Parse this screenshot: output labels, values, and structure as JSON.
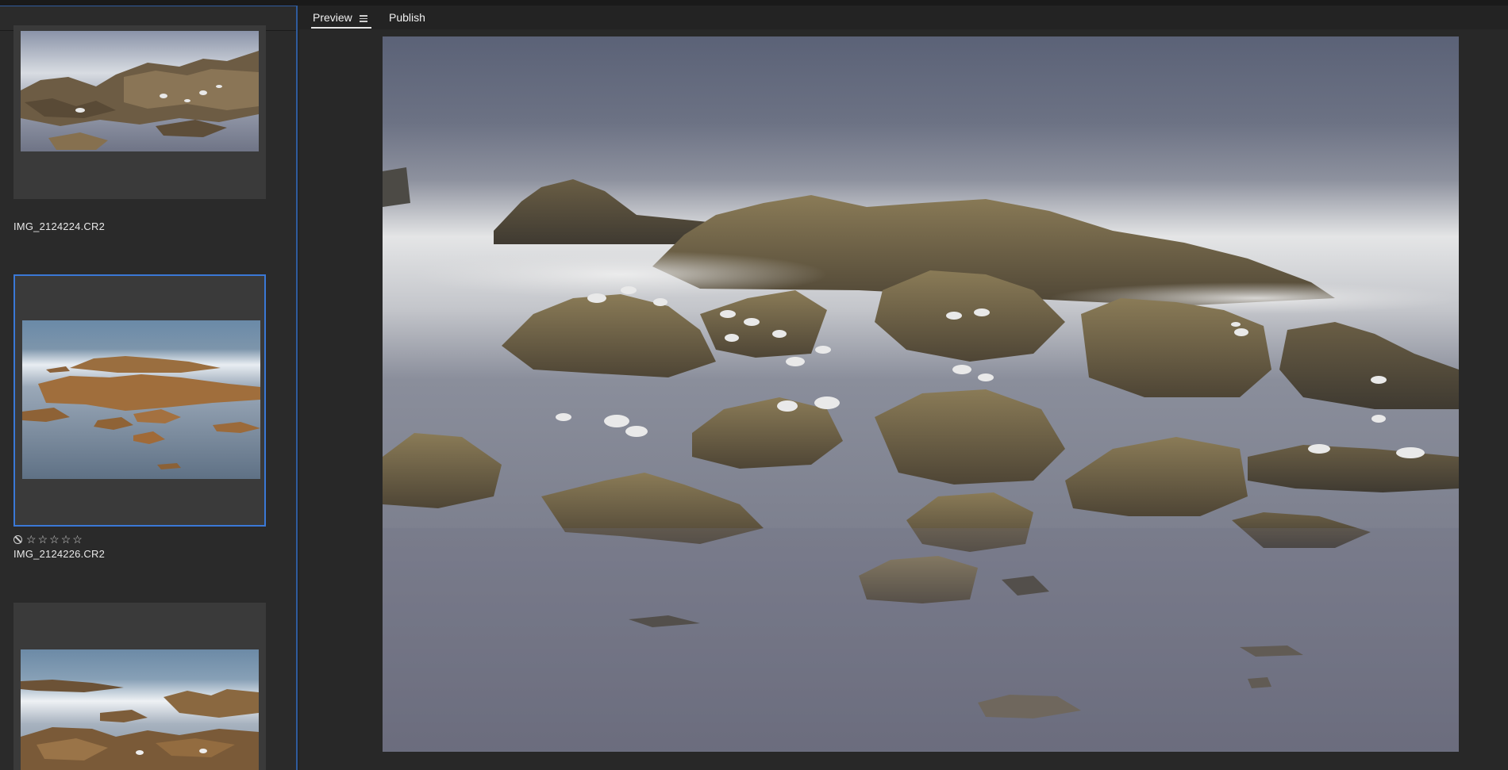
{
  "tabs": {
    "preview_label": "Preview",
    "publish_label": "Publish"
  },
  "filmstrip": {
    "items": [
      {
        "filename": "IMG_2124224.CR2"
      },
      {
        "filename": "IMG_2124226.CR2",
        "rating": 0,
        "rejected_flag_visible": true
      },
      {
        "filename": ""
      }
    ]
  },
  "colors": {
    "accent": "#3a78d6",
    "panel_border": "#2f5b9c",
    "background": "#232323"
  },
  "icons": {
    "tab_menu": "hamburger-menu-icon",
    "reject": "reject-flag-icon",
    "star": "star-outline-icon"
  }
}
